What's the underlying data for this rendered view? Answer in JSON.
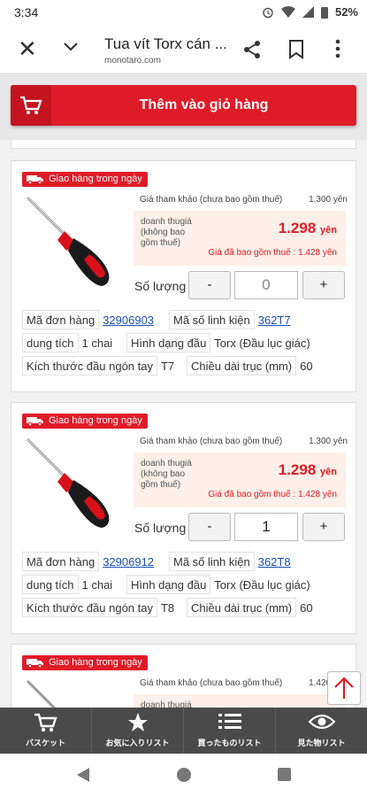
{
  "status": {
    "time": "3:34",
    "battery": "52%"
  },
  "browser": {
    "title": "Tua vít Torx cán ...",
    "url": "monotaro.com"
  },
  "add_to_cart": "Thêm vào giỏ hàng",
  "products": [
    {
      "badge": "Giao hàng trong ngày",
      "ref_price_label": "Giá tham khảo (chưa bao gồm thuế)",
      "ref_price": "1.300 yên",
      "price_label": "doanh thugiá (không bao gồm thuế)",
      "price": "1.298",
      "price_unit": "yên",
      "tax_price": "Giá đã bao gồm thuế : 1.428 yên",
      "qty_label": "Số lượng",
      "qty_minus": "-",
      "qty_plus": "+",
      "qty_value": "",
      "qty_placeholder": "0",
      "order_code_label": "Mã đơn hàng",
      "order_code": "32906903",
      "part_no_label": "Mã số linh kiện",
      "part_no": "362T7",
      "capacity_label": "dung tích",
      "capacity": "1 chai",
      "head_shape_label": "Hình dạng đầu",
      "head_shape": "Torx (Đầu lục giác)",
      "tip_size_label": "Kích thước đầu ngón tay",
      "tip_size": "T7",
      "shaft_len_label": "Chiều dài trục (mm)",
      "shaft_len": "60"
    },
    {
      "badge": "Giao hàng trong ngày",
      "ref_price_label": "Giá tham khảo (chưa bao gồm thuế)",
      "ref_price": "1.300 yên",
      "price_label": "doanh thugiá (không bao gồm thuế)",
      "price": "1.298",
      "price_unit": "yên",
      "tax_price": "Giá đã bao gồm thuế : 1.428 yên",
      "qty_label": "Số lượng",
      "qty_minus": "-",
      "qty_plus": "+",
      "qty_value": "1",
      "qty_placeholder": "",
      "order_code_label": "Mã đơn hàng",
      "order_code": "32906912",
      "part_no_label": "Mã số linh kiện",
      "part_no": "362T8",
      "capacity_label": "dung tích",
      "capacity": "1 chai",
      "head_shape_label": "Hình dạng đầu",
      "head_shape": "Torx (Đầu lục giác)",
      "tip_size_label": "Kích thước đầu ngón tay",
      "tip_size": "T8",
      "shaft_len_label": "Chiều dài trục (mm)",
      "shaft_len": "60"
    },
    {
      "badge": "Giao hàng trong ngày",
      "ref_price_label": "Giá tham khảo (chưa bao gồm thuế)",
      "ref_price": "1.420 yên",
      "price_label": "doanh thugiá"
    }
  ],
  "bottom_nav": [
    "バスケット",
    "お気に入りリスト",
    "買ったものリスト",
    "見た物リスト"
  ],
  "colors": {
    "brand_red": "#e01b28",
    "nav_bg": "#4a4a4a",
    "link": "#1a4fb5"
  },
  "icons": [
    "close-icon",
    "chevron-down-icon",
    "share-icon",
    "bookmark-icon",
    "more-vert-icon",
    "cart-icon",
    "truck-icon",
    "star-icon",
    "list-icon",
    "eye-icon",
    "arrow-up-icon"
  ]
}
